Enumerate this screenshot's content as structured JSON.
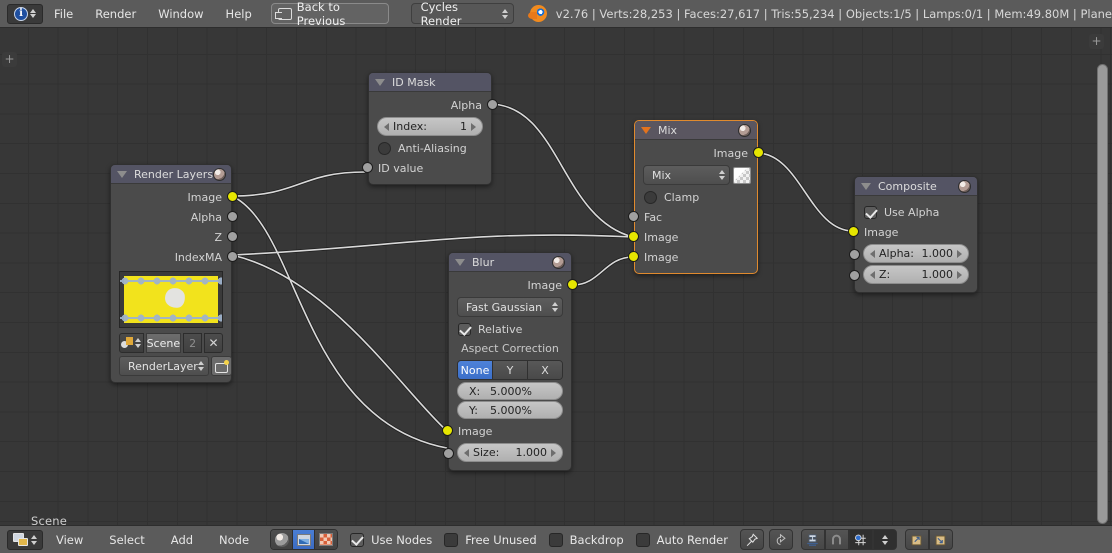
{
  "topbar": {
    "editor_icon": "info-icon",
    "menus": [
      "File",
      "Render",
      "Window",
      "Help"
    ],
    "back_button": {
      "label": "Back to Previous",
      "icon": "screen-back-icon"
    },
    "engine": {
      "value": "Cycles Render"
    },
    "logo_icon": "blender-logo-icon",
    "stats": "v2.76 | Verts:28,253 | Faces:27,617 | Tris:55,234 | Objects:1/5 | Lamps:0/1 | Mem:49.80M | Plane"
  },
  "canvas": {
    "scene_label": "Scene",
    "plus_glyph": "+",
    "grid_color": "#373737",
    "accent_color": "#e08a2e"
  },
  "nodes": {
    "render_layers": {
      "title": "Render Layers",
      "outputs": [
        "Image",
        "Alpha",
        "Z",
        "IndexMA"
      ],
      "scene_row": {
        "name": "Scene",
        "count": "2",
        "close": "✕"
      },
      "layer_row": {
        "name": "RenderLayer"
      }
    },
    "id_mask": {
      "title": "ID Mask",
      "outputs": [
        "Alpha"
      ],
      "index": {
        "label": "Index:",
        "value": "1"
      },
      "anti_aliasing": {
        "label": "Anti-Aliasing",
        "checked": false
      },
      "inputs": [
        "ID value"
      ]
    },
    "blur": {
      "title": "Blur",
      "outputs": [
        "Image"
      ],
      "filter_type": "Fast Gaussian",
      "relative": {
        "label": "Relative",
        "checked": true
      },
      "aspect_correction_label": "Aspect Correction",
      "aspect_options": [
        "None",
        "Y",
        "X"
      ],
      "aspect_selected": "None",
      "x_field": {
        "label": "X:",
        "value": "5.000%"
      },
      "y_field": {
        "label": "Y:",
        "value": "5.000%"
      },
      "inputs": [
        "Image"
      ],
      "size": {
        "label": "Size:",
        "value": "1.000"
      }
    },
    "mix": {
      "title": "Mix",
      "outputs": [
        "Image"
      ],
      "blend_mode": "Mix",
      "clamp": {
        "label": "Clamp",
        "checked": false
      },
      "inputs": [
        "Fac",
        "Image",
        "Image"
      ]
    },
    "composite": {
      "title": "Composite",
      "use_alpha": {
        "label": "Use Alpha",
        "checked": true
      },
      "inputs": [
        "Image"
      ],
      "alpha": {
        "label": "Alpha:",
        "value": "1.000"
      },
      "z": {
        "label": "Z:",
        "value": "1.000"
      }
    }
  },
  "botbar": {
    "editor_icon": "node-editor-icon",
    "menus": [
      "View",
      "Select",
      "Add",
      "Node"
    ],
    "shading_modes": [
      "material-sphere-icon",
      "image-icon",
      "checker-icon"
    ],
    "shading_selected": "image-icon",
    "use_nodes": {
      "label": "Use Nodes",
      "checked": true
    },
    "free_unused": {
      "label": "Free Unused",
      "checked": false
    },
    "backdrop": {
      "label": "Backdrop",
      "checked": false
    },
    "auto_render": {
      "label": "Auto Render",
      "checked": false
    },
    "tool_icons": [
      "pin-icon",
      "go-to-parent-icon",
      "snap-magnet-node-icon",
      "magnet-icon",
      "snap-target-icon",
      "snap-dropdown-icon",
      "copy-icon",
      "paste-icon"
    ]
  }
}
